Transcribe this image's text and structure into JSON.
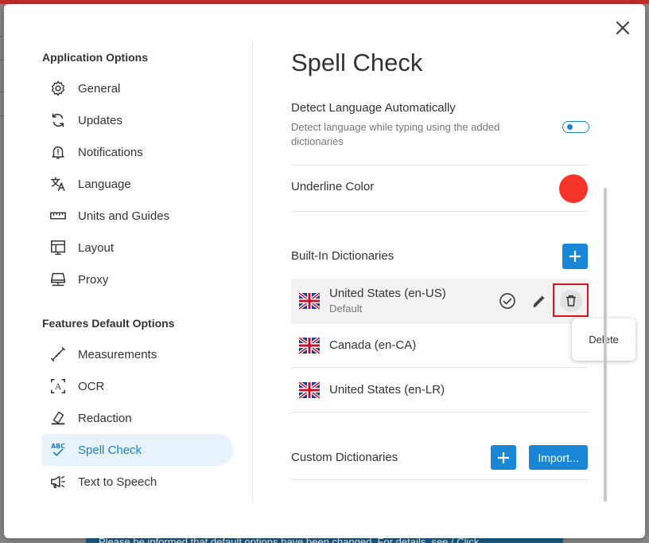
{
  "background": {
    "banner_text": "Please be informed that default options have been changed. For details, see / Click"
  },
  "dialog": {
    "close_label": "Close"
  },
  "sidebar": {
    "app_section_title": "Application Options",
    "app_items": [
      {
        "label": "General",
        "icon": "gear-icon"
      },
      {
        "label": "Updates",
        "icon": "refresh-icon"
      },
      {
        "label": "Notifications",
        "icon": "bell-icon"
      },
      {
        "label": "Language",
        "icon": "translate-icon"
      },
      {
        "label": "Units and Guides",
        "icon": "ruler-icon"
      },
      {
        "label": "Layout",
        "icon": "layout-icon"
      },
      {
        "label": "Proxy",
        "icon": "proxy-icon"
      }
    ],
    "features_section_title": "Features Default Options",
    "feature_items": [
      {
        "label": "Measurements",
        "icon": "measure-icon"
      },
      {
        "label": "OCR",
        "icon": "ocr-icon"
      },
      {
        "label": "Redaction",
        "icon": "eraser-icon"
      },
      {
        "label": "Spell Check",
        "icon": "abc-check-icon",
        "active": true
      },
      {
        "label": "Text to Speech",
        "icon": "megaphone-icon"
      }
    ]
  },
  "main": {
    "title": "Spell Check",
    "detect_language": {
      "title": "Detect Language Automatically",
      "description": "Detect language while typing using the added dictionaries",
      "enabled": false
    },
    "underline_color": {
      "title": "Underline Color",
      "color": "#f5352a"
    },
    "builtin": {
      "title": "Built-In Dictionaries",
      "add_label": "+",
      "dictionaries": [
        {
          "name": "United States (en-US)",
          "sub": "Default",
          "selected": true
        },
        {
          "name": "Canada (en-CA)",
          "sub": ""
        },
        {
          "name": "United States (en-LR)",
          "sub": ""
        }
      ]
    },
    "custom": {
      "title": "Custom Dictionaries",
      "add_label": "+",
      "import_label": "Import..."
    },
    "tooltip": "Delete"
  },
  "colors": {
    "accent": "#1a87d6",
    "active_bg": "#e7f2fb",
    "highlight": "#d9151e",
    "underline": "#f5352a"
  }
}
